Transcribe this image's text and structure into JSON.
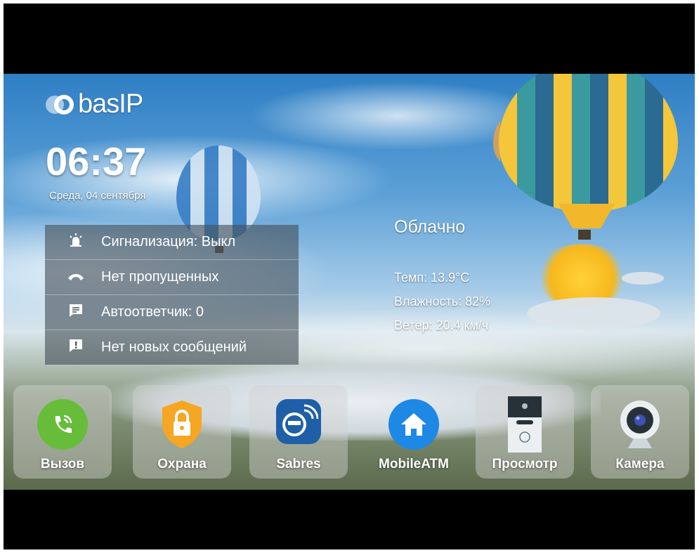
{
  "brand": {
    "logo_text": "basIP"
  },
  "clock": {
    "time": "06:37",
    "date": "Среда, 04 сентября"
  },
  "status": [
    {
      "icon": "alarm-siren-icon",
      "label": "Сигнализация: Выкл"
    },
    {
      "icon": "phone-icon",
      "label": "Нет пропущенных"
    },
    {
      "icon": "message-icon",
      "label": "Автоответчик: 0"
    },
    {
      "icon": "alert-message-icon",
      "label": "Нет новых сообщений"
    }
  ],
  "weather": {
    "condition": "Облачно",
    "temp": "Темп: 13.9°C",
    "humidity": "Влажность: 82%",
    "wind": "Ветер: 20.4 км/ч"
  },
  "apps": [
    {
      "label": "Вызов",
      "icon": "phone-call-icon",
      "color": "#67bd3a"
    },
    {
      "label": "Охрана",
      "icon": "lock-shield-icon",
      "color": "#f5a623"
    },
    {
      "label": "Sabres",
      "icon": "sabres-meter-icon",
      "color": "#1e5fa8"
    },
    {
      "label": "MobileATM",
      "icon": "home-icon",
      "color": "#1e88e5"
    },
    {
      "label": "Просмотр",
      "icon": "intercom-panel-icon",
      "color": "#ffffff"
    },
    {
      "label": "Камера",
      "icon": "webcam-icon",
      "color": "#ffffff"
    }
  ]
}
